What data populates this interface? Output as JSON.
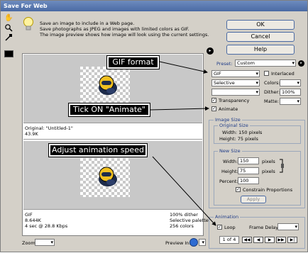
{
  "window": {
    "title": "Save For Web"
  },
  "info": {
    "line1": "Save an image to include in a Web page.",
    "line2": "Save photographs as JPEG and images with limited colors as GIF.",
    "line3": "The image preview shows how image will look using the current settings."
  },
  "buttons": {
    "ok": "OK",
    "cancel": "Cancel",
    "help": "Help"
  },
  "settings": {
    "preset_label": "Preset:",
    "preset_value": "Custom",
    "format_value": "GIF",
    "interlaced_label": "Interlaced",
    "reduction_value": "Selective",
    "colors_label": "Colors:",
    "dither_label": "Dither:",
    "dither_value": "100%",
    "transparency_label": "Transparency",
    "matte_label": "Matte:",
    "animate_label": "Animate"
  },
  "image_size": {
    "group_title": "Image Size",
    "original_title": "Original Size",
    "orig_width": "Width: 150 pixels",
    "orig_height": "Height: 75 pixels",
    "new_title": "New Size",
    "width_label": "Width:",
    "width_value": "150",
    "height_label": "Height:",
    "height_value": "75",
    "pixels": "pixels",
    "percent_label": "Percent:",
    "percent_value": "100",
    "constrain_label": "Constrain Proportions",
    "apply_label": "Apply"
  },
  "animation": {
    "group_title": "Animation",
    "loop_label": "Loop",
    "frame_delay_label": "Frame Delay:",
    "counter": "1 of 4"
  },
  "previews": {
    "top_info_line1": "Original: \"Untitled-1\"",
    "top_info_line2": "43.9K",
    "bottom_info_left1": "GIF",
    "bottom_info_left2": "8.644K",
    "bottom_info_left3": "4 sec @ 28.8 Kbps",
    "bottom_info_right1": "100% dither",
    "bottom_info_right2": "Selective palette",
    "bottom_info_right3": "256 colors"
  },
  "footer": {
    "zoom_label": "Zoom:",
    "preview_label": "Preview In:"
  },
  "callouts": {
    "gif_format": "GIF format",
    "tick_animate": "Tick ON \"Animate\"",
    "adjust_speed": "Adjust animation speed"
  }
}
